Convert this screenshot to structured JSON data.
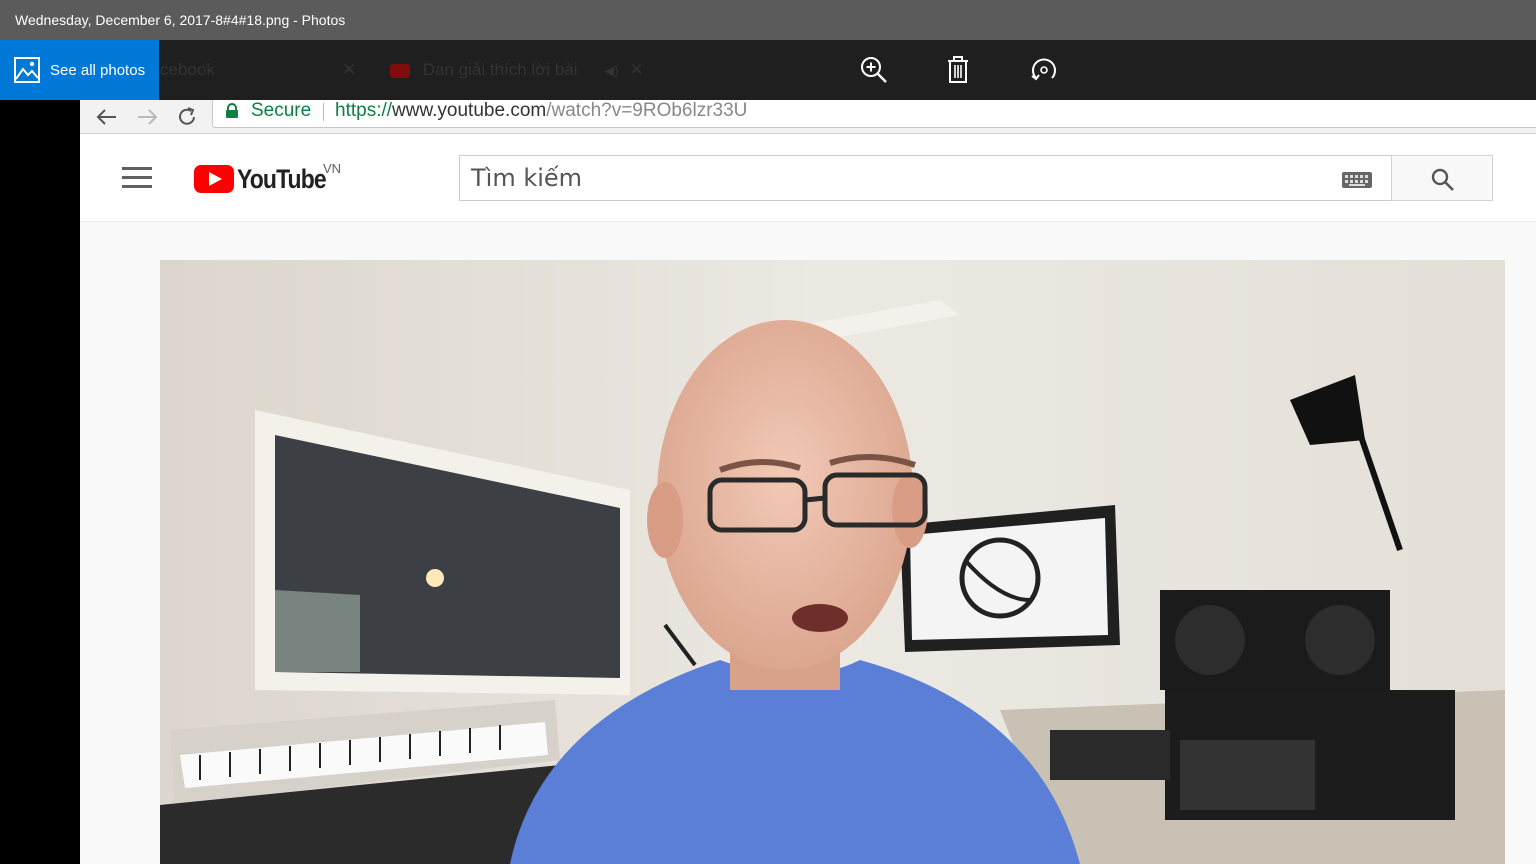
{
  "window": {
    "title": "Wednesday, December 6, 2017-8#4#18.png - Photos"
  },
  "photos_toolbar": {
    "see_all_label": "See all photos",
    "zoom_icon": "zoom-in-icon",
    "delete_icon": "trash-icon",
    "rotate_icon": "rotate-icon"
  },
  "browser": {
    "tabs": [
      {
        "label": "cebook"
      },
      {
        "label": "Dan giải thích lời bài"
      }
    ],
    "secure_label": "Secure",
    "url_scheme": "https://",
    "url_host": "www.youtube.com",
    "url_path": "/watch?v=9ROb6lzr33U"
  },
  "youtube": {
    "logo_text": "YouTube",
    "region": "VN",
    "search_placeholder": "Tìm kiếm"
  },
  "colors": {
    "accent": "#0078d7",
    "youtube_red": "#ff0000",
    "secure_green": "#0b8043"
  }
}
